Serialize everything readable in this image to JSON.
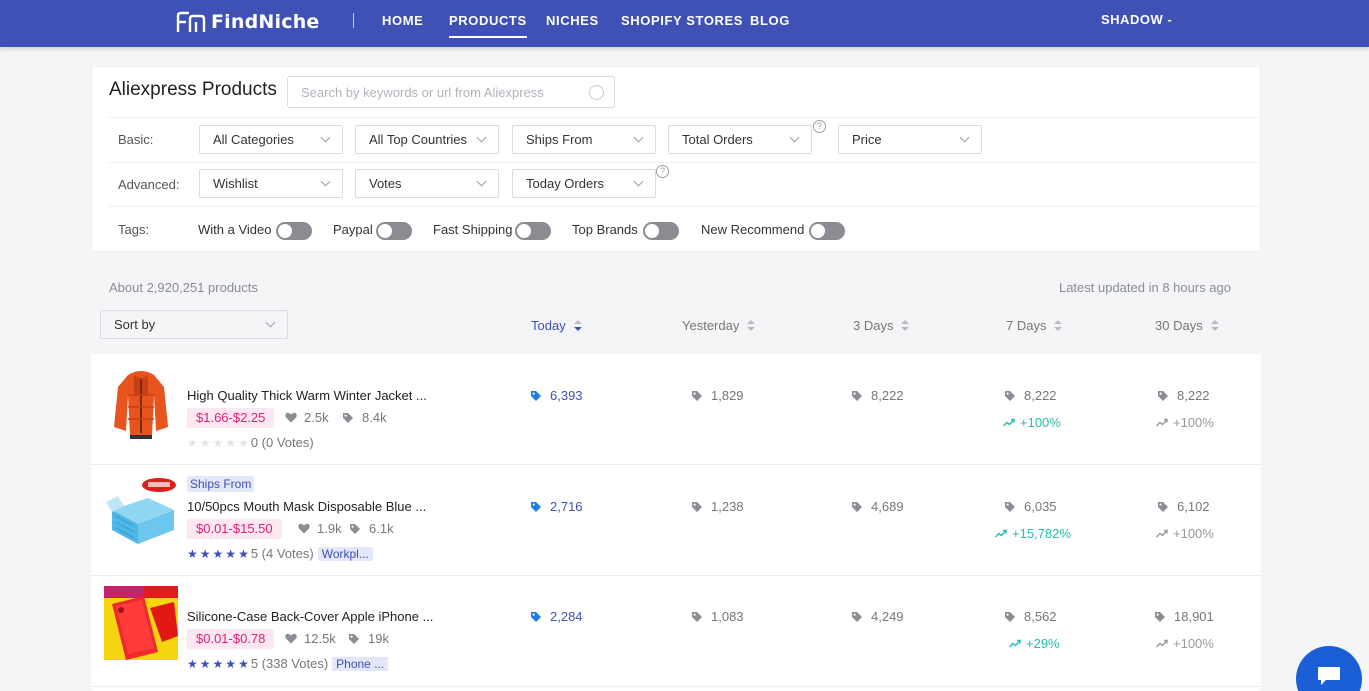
{
  "nav": {
    "brand": "FindNiche",
    "links": [
      "HOME",
      "PRODUCTS",
      "NICHES",
      "SHOPIFY STORES",
      "BLOG"
    ],
    "active": "PRODUCTS",
    "user": "SHADOW -"
  },
  "filters": {
    "title": "Aliexpress Products",
    "search_placeholder": "Search by keywords or url from Aliexpress",
    "basic_label": "Basic:",
    "basic": [
      "All Categories",
      "All Top Countries",
      "Ships From",
      "Total Orders",
      "Price"
    ],
    "advanced_label": "Advanced:",
    "advanced": [
      "Wishlist",
      "Votes",
      "Today Orders"
    ],
    "help_glyph": "?",
    "tags_label": "Tags:",
    "tags": [
      "With a Video",
      "Paypal",
      "Fast Shipping",
      "Top Brands",
      "New Recommend"
    ]
  },
  "results": {
    "count": "About 2,920,251 products",
    "updated": "Latest updated in 8 hours ago",
    "sort_by": "Sort by",
    "columns": [
      "Today",
      "Yesterday",
      "3 Days",
      "7 Days",
      "30 Days"
    ],
    "active_column": "Today"
  },
  "products": [
    {
      "title": "High Quality Thick Warm Winter Jacket ...",
      "ships_from": "",
      "price": "$1.66-$2.25",
      "wishlist": "2.5k",
      "orders": "8.4k",
      "rating": 0,
      "rating_text": "0 (0 Votes)",
      "category": "",
      "today": "6,393",
      "yesterday": "1,829",
      "three_days": "8,222",
      "seven_days": "8,222",
      "seven_growth": "+100%",
      "thirty_days": "8,222",
      "thirty_growth": "+100%"
    },
    {
      "title": "10/50pcs Mouth Mask Disposable Blue ...",
      "ships_from": "Ships From",
      "price": "$0.01-$15.50",
      "wishlist": "1.9k",
      "orders": "6.1k",
      "rating": 5,
      "rating_text": "5 (4 Votes)",
      "category": "Workpl...",
      "today": "2,716",
      "yesterday": "1,238",
      "three_days": "4,689",
      "seven_days": "6,035",
      "seven_growth": "+15,782%",
      "thirty_days": "6,102",
      "thirty_growth": "+100%"
    },
    {
      "title": "Silicone-Case Back-Cover Apple iPhone ...",
      "ships_from": "",
      "price": "$0.01-$0.78",
      "wishlist": "12.5k",
      "orders": "19k",
      "rating": 5,
      "rating_text": "5 (338 Votes)",
      "category": "Phone ...",
      "today": "2,284",
      "yesterday": "1,083",
      "three_days": "4,249",
      "seven_days": "8,562",
      "seven_growth": "+29%",
      "thirty_days": "18,901",
      "thirty_growth": "+100%"
    }
  ],
  "colors": {
    "brand": "#3f51b5",
    "price_text": "#e0217a",
    "growth_up": "#22bfb1",
    "chat": "#1a5fd6"
  }
}
